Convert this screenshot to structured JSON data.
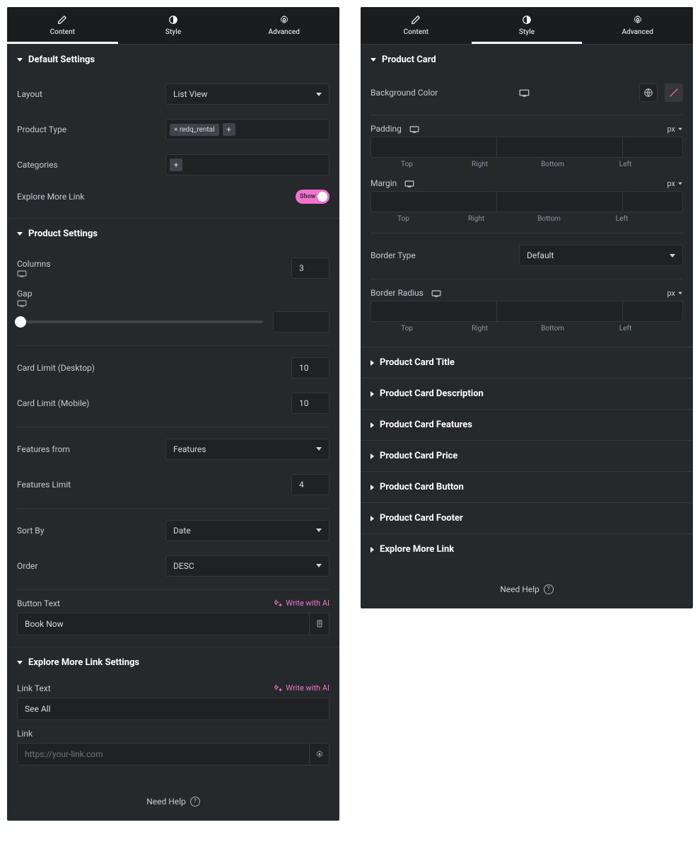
{
  "tabs": {
    "content": "Content",
    "style": "Style",
    "advanced": "Advanced"
  },
  "left": {
    "defaultSettings": {
      "title": "Default Settings",
      "layout_label": "Layout",
      "layout_value": "List View",
      "product_type_label": "Product Type",
      "product_type_tag": "× redq_rental",
      "categories_label": "Categories",
      "explore_label": "Explore More Link",
      "explore_toggle": "Show"
    },
    "productSettings": {
      "title": "Product Settings",
      "columns_label": "Columns",
      "columns_value": "3",
      "gap_label": "Gap",
      "card_limit_desktop_label": "Card Limit (Desktop)",
      "card_limit_desktop_value": "10",
      "card_limit_mobile_label": "Card Limit (Mobile)",
      "card_limit_mobile_value": "10",
      "features_from_label": "Features from",
      "features_from_value": "Features",
      "features_limit_label": "Features Limit",
      "features_limit_value": "4",
      "sort_by_label": "Sort By",
      "sort_by_value": "Date",
      "order_label": "Order",
      "order_value": "DESC",
      "button_text_label": "Button Text",
      "button_text_value": "Book Now",
      "ai_label": "Write with AI"
    },
    "exploreSettings": {
      "title": "Explore More Link Settings",
      "link_text_label": "Link Text",
      "link_text_value": "See All",
      "link_label": "Link",
      "link_placeholder": "https://your-link.com"
    }
  },
  "right": {
    "productCard": {
      "title": "Product Card",
      "bg_color_label": "Background Color",
      "padding_label": "Padding",
      "margin_label": "Margin",
      "border_type_label": "Border Type",
      "border_type_value": "Default",
      "border_radius_label": "Border Radius",
      "unit": "px",
      "sides": {
        "top": "Top",
        "right": "Right",
        "bottom": "Bottom",
        "left": "Left"
      }
    },
    "collapsed": [
      "Product Card Title",
      "Product Card Description",
      "Product Card Features",
      "Product Card Price",
      "Product Card Button",
      "Product Card Footer",
      "Explore More Link"
    ]
  },
  "help": "Need Help"
}
